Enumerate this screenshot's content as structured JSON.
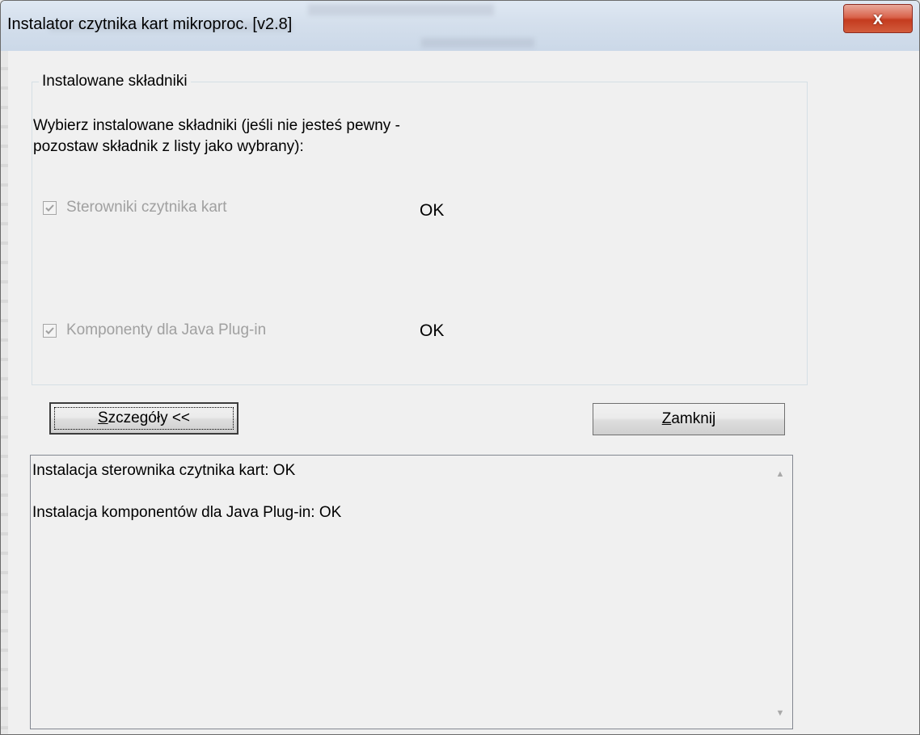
{
  "window": {
    "title": "Instalator czytnika kart mikroproc. [v2.8]",
    "close_glyph": "x"
  },
  "group": {
    "legend": "Instalowane składniki",
    "instructions_line1": "Wybierz instalowane składniki (jeśli nie jesteś pewny -",
    "instructions_line2": "pozostaw składnik z listy jako wybrany):"
  },
  "components": [
    {
      "label": "Sterowniki czytnika kart",
      "checked": true,
      "enabled": false,
      "status": "OK"
    },
    {
      "label": "Komponenty dla Java Plug-in",
      "checked": true,
      "enabled": false,
      "status": "OK"
    }
  ],
  "buttons": {
    "details": {
      "mnemonic": "S",
      "rest": "zczegóły <<"
    },
    "close": {
      "mnemonic": "Z",
      "rest": "amknij"
    }
  },
  "log": {
    "lines": [
      "Instalacja sterownika czytnika kart: OK",
      "Instalacja komponentów dla Java Plug-in: OK"
    ]
  },
  "colors": {
    "close_button": "#c43b1f",
    "disabled_text": "#a0a0a0",
    "dialog_bg": "#f0f0f0"
  }
}
